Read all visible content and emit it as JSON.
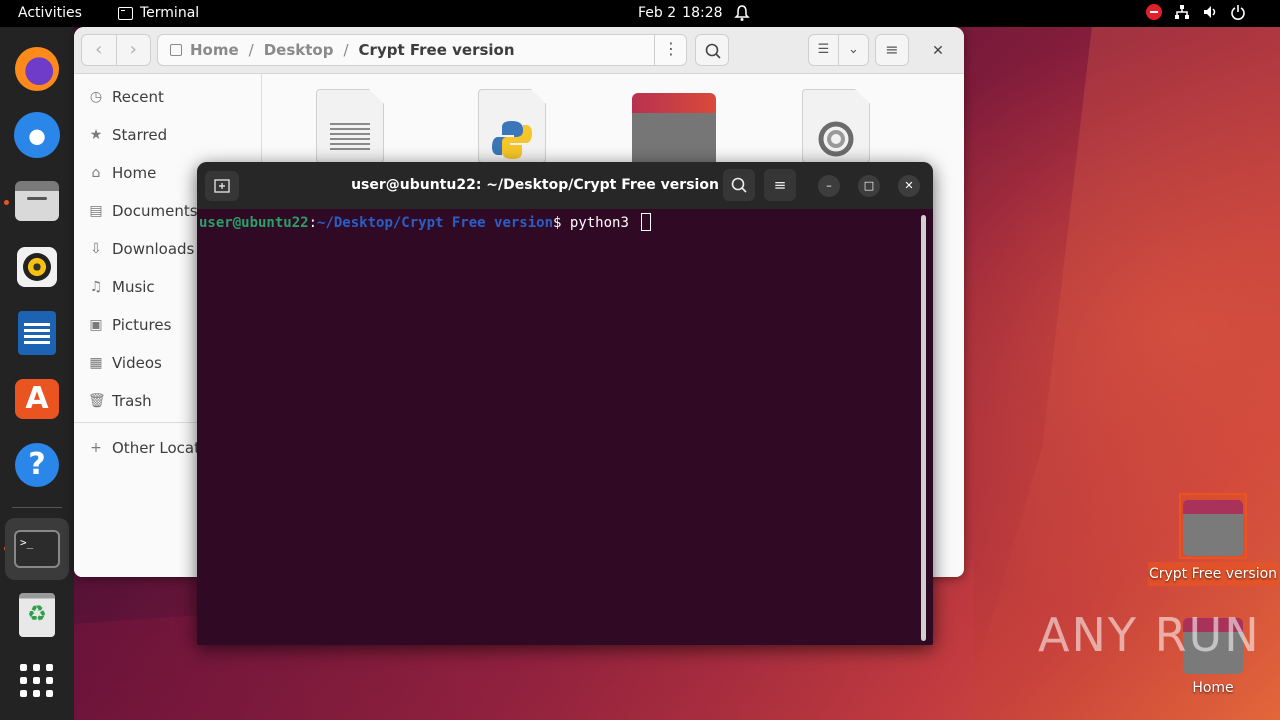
{
  "topbar": {
    "activities": "Activities",
    "app_name": "Terminal",
    "date": "Feb 2",
    "time": "18:28"
  },
  "dock": {
    "items": [
      "firefox-icon",
      "thunderbird-icon",
      "files-icon",
      "rhythmbox-icon",
      "libreoffice-writer-icon",
      "app-center-icon",
      "help-icon",
      "terminal-icon",
      "trash-icon",
      "show-apps-icon"
    ],
    "terminal_glyph": ">_"
  },
  "files": {
    "path": [
      "Home",
      "Desktop",
      "Crypt Free version"
    ],
    "sidebar": [
      {
        "label": "Recent",
        "icon": "clock-icon"
      },
      {
        "label": "Starred",
        "icon": "star-icon"
      },
      {
        "label": "Home",
        "icon": "home-icon"
      },
      {
        "label": "Documents",
        "icon": "document-icon"
      },
      {
        "label": "Downloads",
        "icon": "download-icon"
      },
      {
        "label": "Music",
        "icon": "music-icon"
      },
      {
        "label": "Pictures",
        "icon": "picture-icon"
      },
      {
        "label": "Videos",
        "icon": "video-icon"
      },
      {
        "label": "Trash",
        "icon": "trash-icon"
      },
      {
        "label": "Other Locat",
        "icon": "plus-icon"
      }
    ]
  },
  "terminal": {
    "title": "user@ubuntu22: ~/Desktop/Crypt Free version",
    "prompt_user": "user@ubuntu22",
    "prompt_colon": ":",
    "prompt_path": "~/Desktop/Crypt Free version",
    "prompt_symbol": "$ ",
    "command": "python3 "
  },
  "desktop": {
    "icons": [
      {
        "label": "Crypt Free version"
      },
      {
        "label": "Home"
      }
    ],
    "watermark": "ANY RUN"
  }
}
